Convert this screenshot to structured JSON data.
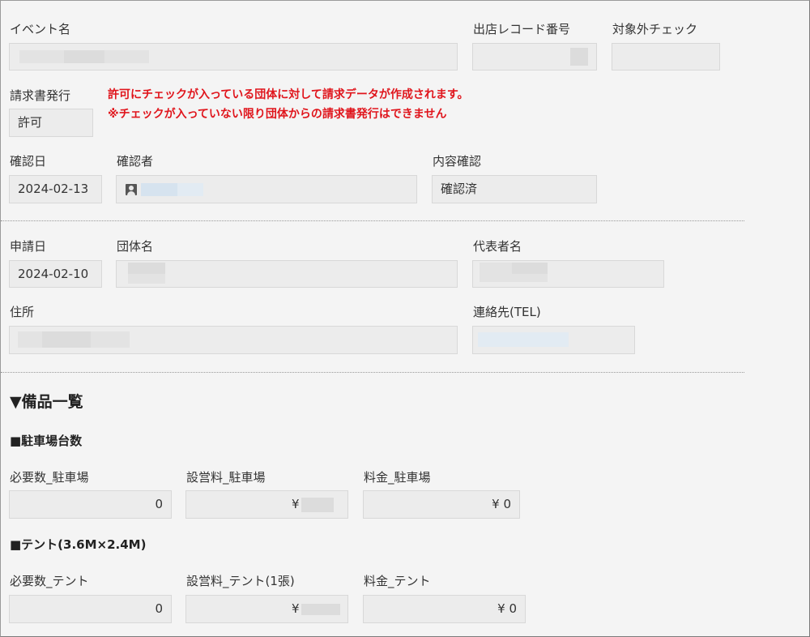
{
  "row1": {
    "event_name_label": "イベント名",
    "record_no_label": "出店レコード番号",
    "exclude_check_label": "対象外チェック"
  },
  "billing": {
    "label": "請求書発行",
    "value": "許可",
    "notice_line1": "許可にチェックが入っている団体に対して請求データが作成されます。",
    "notice_line2": "※チェックが入っていない限り団体からの請求書発行はできません"
  },
  "confirm": {
    "date_label": "確認日",
    "date_value": "2024-02-13",
    "confirmer_label": "確認者",
    "content_label": "内容確認",
    "content_value": "確認済"
  },
  "applicant": {
    "apply_date_label": "申請日",
    "apply_date_value": "2024-02-10",
    "org_label": "団体名",
    "rep_label": "代表者名",
    "address_label": "住所",
    "tel_label": "連絡先(TEL)"
  },
  "equipment": {
    "heading": "▼備品一覧",
    "parking": {
      "title": "■駐車場台数",
      "qty_label": "必要数_駐車場",
      "qty_value": "0",
      "unit_label": "設営料_駐車場",
      "unit_value": "¥",
      "fee_label": "料金_駐車場",
      "fee_value": "¥ 0"
    },
    "tent": {
      "title": "■テント(3.6M×2.4M)",
      "qty_label": "必要数_テント",
      "qty_value": "0",
      "unit_label": "設営料_テント(1張)",
      "unit_value": "¥",
      "fee_label": "料金_テント",
      "fee_value": "¥ 0"
    }
  },
  "icons": {
    "confirmer": "user-icon"
  }
}
